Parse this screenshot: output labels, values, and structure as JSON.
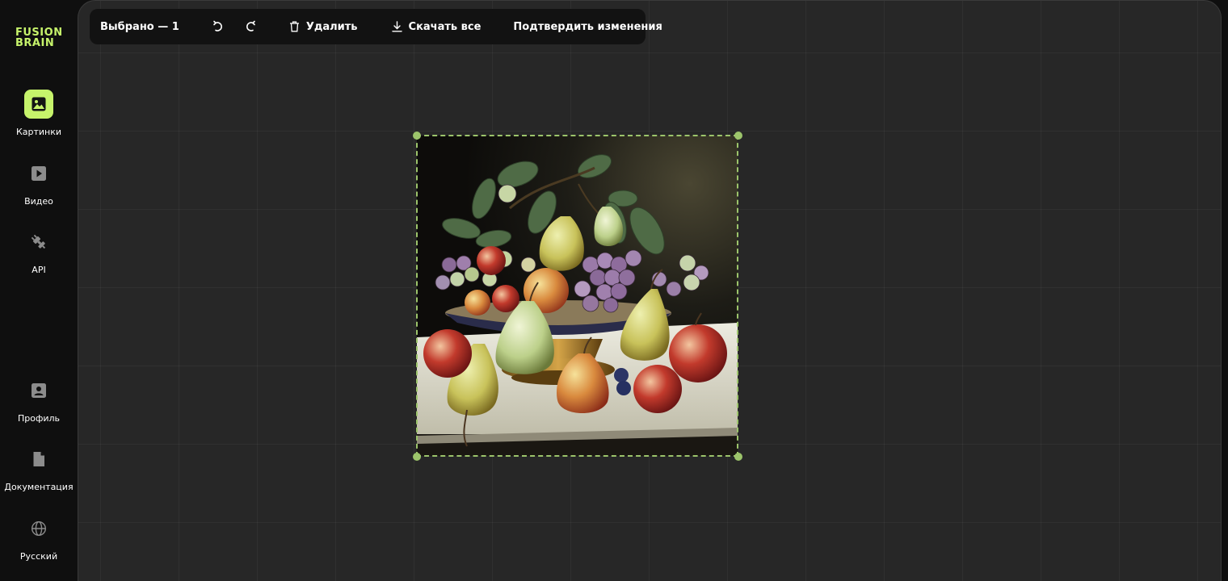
{
  "brand": {
    "line1": "FUSION",
    "line2": "BRAIN"
  },
  "sidebar": {
    "top_items": [
      {
        "label": "Картинки",
        "icon": "image-icon",
        "active": true
      },
      {
        "label": "Видео",
        "icon": "play-icon",
        "active": false
      },
      {
        "label": "API",
        "icon": "plug-icon",
        "active": false
      }
    ],
    "bottom_items": [
      {
        "label": "Профиль",
        "icon": "profile-icon"
      },
      {
        "label": "Документация",
        "icon": "document-icon"
      },
      {
        "label": "Русский",
        "icon": "globe-icon"
      }
    ]
  },
  "toolbar": {
    "selected_label": "Выбрано — 1",
    "undo_icon": "undo-icon",
    "redo_icon": "redo-icon",
    "delete_label": "Удалить",
    "download_label": "Скачать все",
    "confirm_label": "Подтвердить изменения"
  },
  "colors": {
    "accent": "#c6f36b",
    "selection": "#9cc46b",
    "canvas_bg": "#272727",
    "sidebar_bg": "#0f0f0f"
  }
}
